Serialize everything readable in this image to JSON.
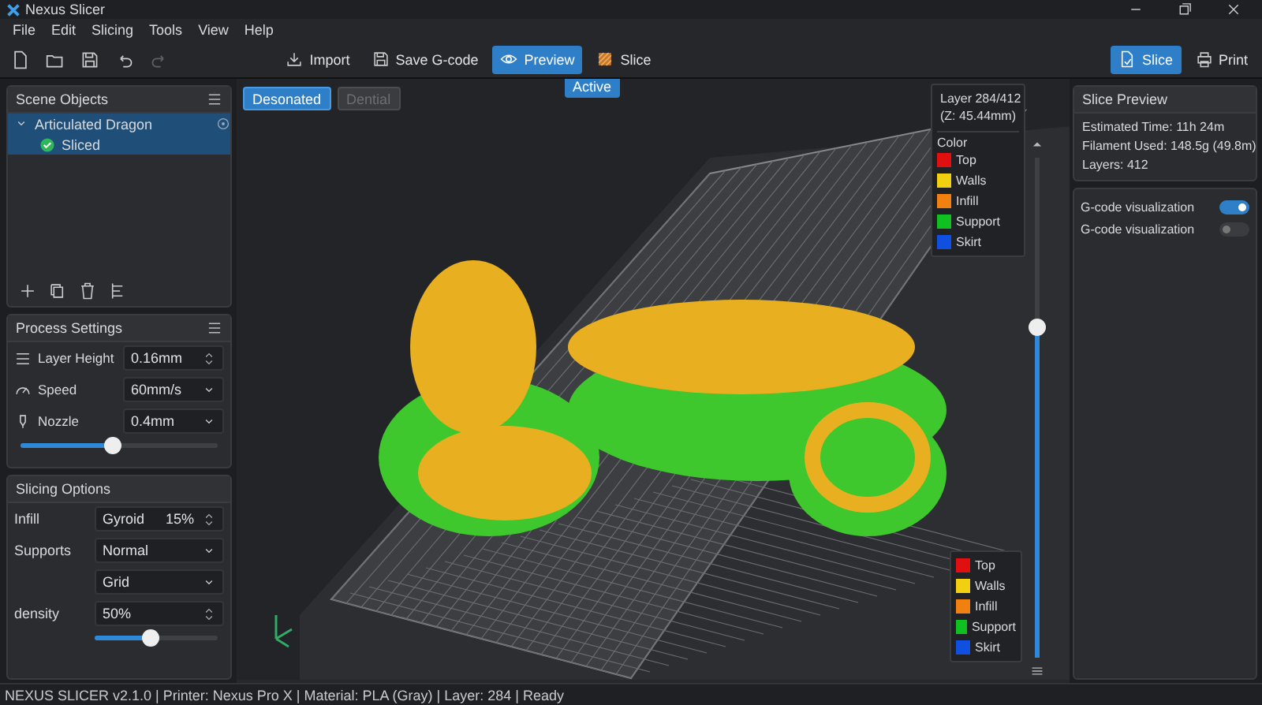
{
  "window": {
    "title": "Nexus Slicer"
  },
  "menu": [
    "File",
    "Edit",
    "Slicing",
    "Tools",
    "View",
    "Help"
  ],
  "toolbar": {
    "left": [
      {
        "disabled": false
      },
      {
        "disabled": false
      },
      {
        "disabled": false
      },
      {
        "disabled": false
      },
      {
        "disabled": true
      }
    ],
    "center": [
      {
        "label": "Import",
        "selected": false
      },
      {
        "label": "Save G-code",
        "selected": false
      },
      {
        "label": "Preview",
        "selected": true
      },
      {
        "label": "Slice",
        "selected": false
      }
    ],
    "right": [
      {
        "label": "Slice",
        "selected": true
      },
      {
        "label": "Print",
        "selected": false
      }
    ]
  },
  "tooltip": "Active",
  "scene_objects": {
    "title": "Scene Objects",
    "items": [
      {
        "label": "Articulated Dragon",
        "expanded": true,
        "children": [
          {
            "label": "Sliced"
          }
        ]
      }
    ]
  },
  "process_settings": {
    "title": "Process Settings",
    "rows": [
      {
        "label": "Layer Height",
        "kind": "spin",
        "value": "0.16mm"
      },
      {
        "label": "Speed",
        "kind": "select",
        "value": "60mm/s"
      },
      {
        "label": "Nozzle",
        "kind": "select",
        "value": "0.4mm"
      }
    ],
    "slider": {
      "level": 0.46
    }
  },
  "slicing_options": {
    "title": "Slicing Options",
    "rows": [
      {
        "label": "Infill",
        "kind": "spin",
        "value": "Gyroid",
        "extra": "15%"
      },
      {
        "label": "Supports",
        "kind": "select",
        "value": "Normal"
      },
      {
        "kind": "select",
        "value": "Grid"
      },
      {
        "label": "density",
        "kind": "spin",
        "value": "50%"
      }
    ],
    "slider": {
      "level": 0.45
    }
  },
  "view_modes": [
    {
      "label": "Desonated",
      "disabled": false,
      "selected": true
    },
    {
      "label": "Dential",
      "disabled": true,
      "selected": false
    }
  ],
  "layer_info": {
    "layer": "Layer 284/412",
    "z": "(Z: 45.44mm)"
  },
  "legend_top": {
    "title": "Color",
    "items": [
      {
        "label": "Top",
        "color": "#e01010"
      },
      {
        "label": "Walls",
        "color": "#f0d010"
      },
      {
        "label": "Infill",
        "color": "#f08010"
      },
      {
        "label": "Support",
        "color": "#10c020"
      },
      {
        "label": "Skirt",
        "color": "#1050e0"
      }
    ]
  },
  "legend_bottom": {
    "items": [
      {
        "label": "Top",
        "color": "#e01010"
      },
      {
        "label": "Walls",
        "color": "#f0d010"
      },
      {
        "label": "Infill",
        "color": "#f08010"
      },
      {
        "label": "Support",
        "color": "#10c020"
      },
      {
        "label": "Skirt",
        "color": "#1050e0"
      }
    ]
  },
  "layer_slider": {
    "level": 0.66
  },
  "slice_preview": {
    "title": "Slice Preview",
    "lines": [
      "Estimated Time: 11h 24m",
      "Filament Used: 148.5g (49.8m)",
      "Layers: 412"
    ]
  },
  "toggles": [
    {
      "label": "G-code visualization",
      "on": true
    },
    {
      "label": "G-code visualization",
      "on": false
    }
  ],
  "status_bar": {
    "text": "NEXUS SLICER v2.1.0 | Printer: Nexus Pro X | Material: PLA (Gray) | Layer: 284 | Ready"
  }
}
